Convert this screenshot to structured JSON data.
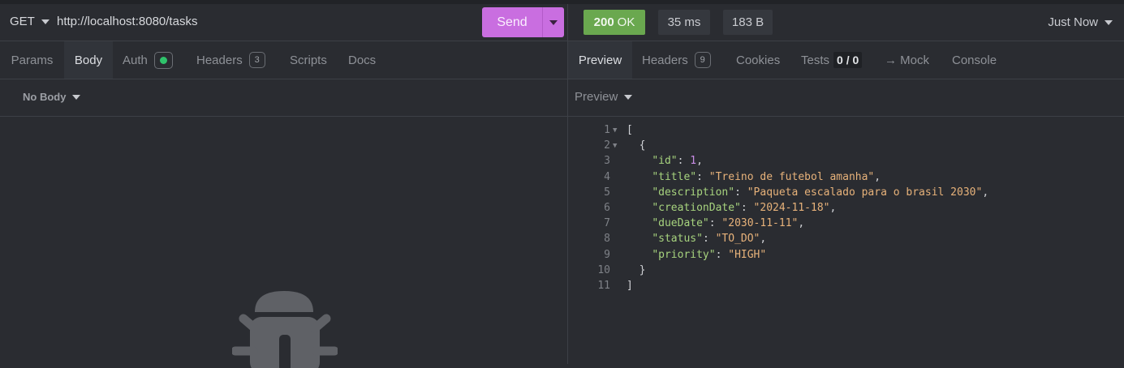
{
  "request": {
    "method": "GET",
    "url": "http://localhost:8080/tasks",
    "send_label": "Send",
    "tabs": [
      {
        "label": "Params"
      },
      {
        "label": "Body"
      },
      {
        "label": "Auth"
      },
      {
        "label": "Headers",
        "badge": "3"
      },
      {
        "label": "Scripts"
      },
      {
        "label": "Docs"
      }
    ],
    "body_mode": "No Body"
  },
  "response": {
    "status_code": "200",
    "status_text": "OK",
    "time": "35 ms",
    "size": "183 B",
    "timestamp": "Just Now",
    "tabs": [
      {
        "label": "Preview"
      },
      {
        "label": "Headers",
        "badge": "9"
      },
      {
        "label": "Cookies"
      },
      {
        "label": "Tests",
        "badge": "0 / 0"
      },
      {
        "label": "→ Mock"
      },
      {
        "label": "Console"
      }
    ],
    "preview_mode": "Preview",
    "json_lines": [
      {
        "n": "1",
        "text": "["
      },
      {
        "n": "2",
        "text": "  {"
      },
      {
        "n": "3",
        "key": "id",
        "value": "1",
        "type": "number",
        "comma": ","
      },
      {
        "n": "4",
        "key": "title",
        "value": "\"Treino de futebol amanha\"",
        "type": "string",
        "comma": ","
      },
      {
        "n": "5",
        "key": "description",
        "value": "\"Paqueta escalado para o brasil 2030\"",
        "type": "string",
        "comma": ","
      },
      {
        "n": "6",
        "key": "creationDate",
        "value": "\"2024-11-18\"",
        "type": "string",
        "comma": ","
      },
      {
        "n": "7",
        "key": "dueDate",
        "value": "\"2030-11-11\"",
        "type": "string",
        "comma": ","
      },
      {
        "n": "8",
        "key": "status",
        "value": "\"TO_DO\"",
        "type": "string",
        "comma": ","
      },
      {
        "n": "9",
        "key": "priority",
        "value": "\"HIGH\"",
        "type": "string",
        "comma": ""
      },
      {
        "n": "10",
        "text": "  }"
      },
      {
        "n": "11",
        "text": "]"
      }
    ]
  },
  "colors": {
    "send": "#c96ee0",
    "status_ok": "#6aa84f",
    "auth_dot": "#2fc36b",
    "json_key": "#a7d37e",
    "json_string": "#e7b27a",
    "json_number": "#c98de6"
  },
  "icons": {
    "empty_state": "bug-icon"
  }
}
